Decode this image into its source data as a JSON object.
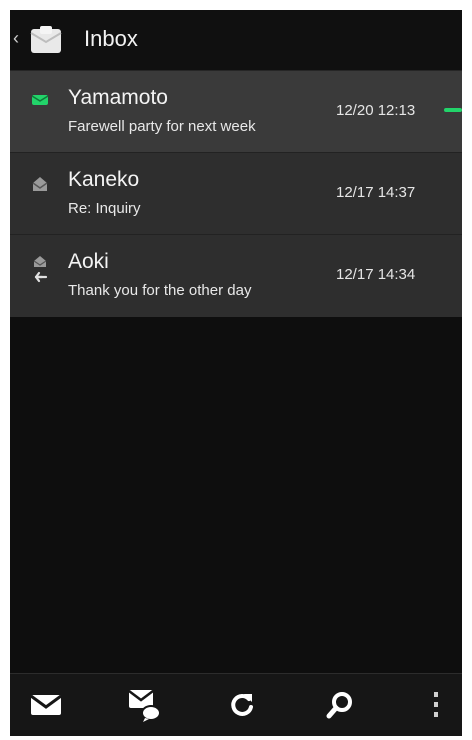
{
  "header": {
    "title": "Inbox",
    "back_icon": "chevron-left-icon",
    "folder_icon": "envelope-icon"
  },
  "messages": [
    {
      "sender": "Yamamoto",
      "subject": "Farewell party for next week",
      "time": "12/20 12:13",
      "status_icon": "unread-mail-icon",
      "unread": true,
      "new_marker_color": "#22d46a"
    },
    {
      "sender": "Kaneko",
      "subject": "Re: Inquiry",
      "time": "12/17 14:37",
      "status_icon": "read-mail-icon",
      "unread": false
    },
    {
      "sender": "Aoki",
      "subject": "Thank you for the other day",
      "time": "12/17 14:34",
      "status_icon": "replied-icon",
      "unread": false
    }
  ],
  "bottom_bar": {
    "buttons": [
      "compose-icon",
      "compose-message-icon",
      "refresh-icon",
      "search-icon",
      "more-icon"
    ]
  },
  "colors": {
    "accent": "#22d46a",
    "background": "#0e0e0e",
    "list_background": "#2e2e2e"
  }
}
